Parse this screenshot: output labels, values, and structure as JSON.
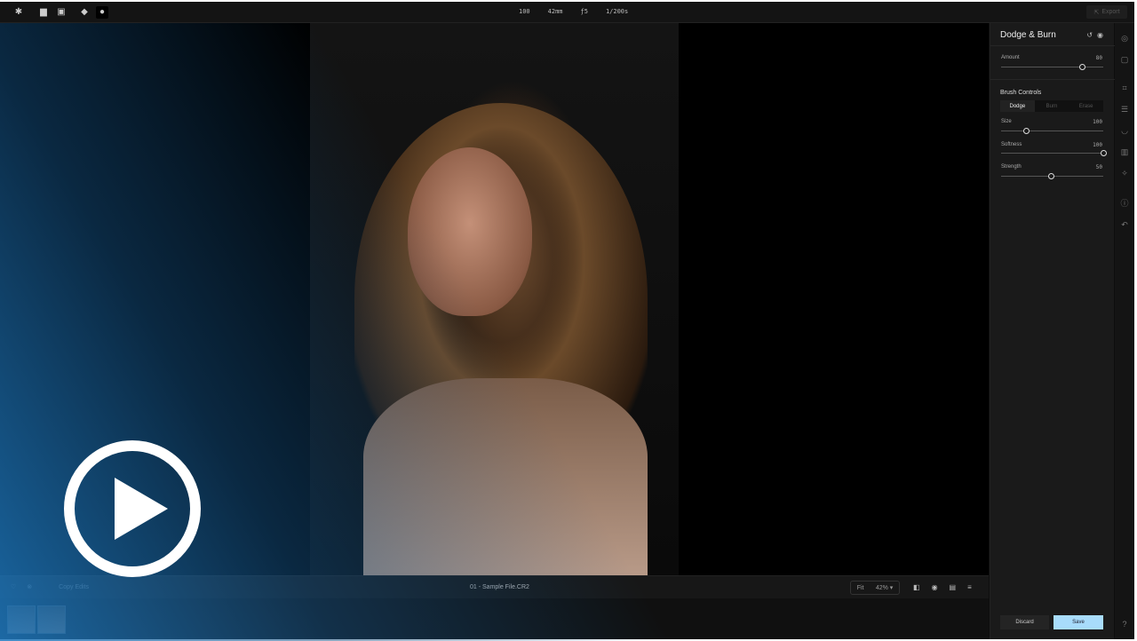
{
  "topbar": {
    "exif": [
      "100",
      "42mm",
      "ƒ5",
      "1/200s"
    ],
    "export_label": "Export"
  },
  "canvas": {
    "filename": "01 - Sample File.CR2",
    "copy_edits": "Copy Edits",
    "fit": "Fit",
    "zoom": "42% ▾"
  },
  "panel": {
    "title": "Dodge & Burn",
    "amount": {
      "label": "Amount",
      "value": "80",
      "fraction": 0.79
    },
    "brush_title": "Brush Controls",
    "modes": [
      "Dodge",
      "Burn",
      "Erase"
    ],
    "active_mode": "Dodge",
    "sliders": [
      {
        "label": "Size",
        "value": "100",
        "fraction": 0.24
      },
      {
        "label": "Softness",
        "value": "100",
        "fraction": 1.0
      },
      {
        "label": "Strength",
        "value": "50",
        "fraction": 0.49
      }
    ],
    "discard": "Discard",
    "save": "Save"
  },
  "colors": {
    "accent": "#a8dcfb"
  }
}
